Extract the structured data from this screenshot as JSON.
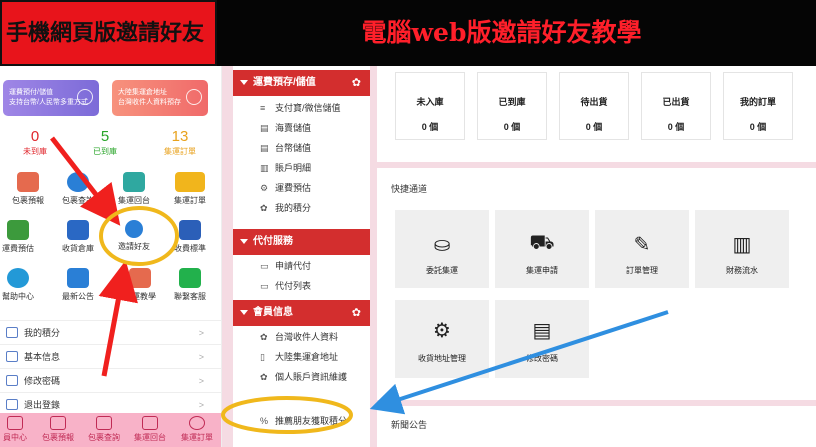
{
  "banners": {
    "left": "手機網頁版邀請好友",
    "right": "電腦web版邀請好友教學"
  },
  "phone": {
    "promo1": [
      "運費預付/儲值",
      "支持台幣/人民幣多重方式"
    ],
    "promo2": [
      "大陸集運倉地址",
      "台灣收件人資料預存"
    ],
    "stats": [
      {
        "num": "0",
        "label": "未到庫",
        "color": "#e0262c"
      },
      {
        "num": "5",
        "label": "已到庫",
        "color": "#2aa52a"
      },
      {
        "num": "13",
        "label": "集運訂單",
        "color": "#e8a21d"
      }
    ],
    "grid": [
      {
        "label": "包裹預報",
        "icon": "parcel-icon",
        "color": "#e56a4e"
      },
      {
        "label": "包裹查詢",
        "icon": "search-icon",
        "color": "#2a7fd6"
      },
      {
        "label": "集運回台",
        "icon": "box-icon",
        "color": "#2fa8a0"
      },
      {
        "label": "集運訂單",
        "icon": "truck-icon",
        "color": "#f1b51c"
      },
      {
        "label": "運費預估",
        "icon": "calculator-icon",
        "color": "#3c9a3c"
      },
      {
        "label": "收貨倉庫",
        "icon": "warehouse-icon",
        "color": "#2a68c4"
      },
      {
        "label": "邀請好友",
        "icon": "user-icon",
        "color": "#2a7fd6"
      },
      {
        "label": "收費標準",
        "icon": "layers-icon",
        "color": "#2b5fb8"
      },
      {
        "label": "幫助中心",
        "icon": "help-icon",
        "color": "#2399d7"
      },
      {
        "label": "最新公告",
        "icon": "announce-icon",
        "color": "#2a7fd6"
      },
      {
        "label": "集運教學",
        "icon": "book-icon",
        "color": "#e56a4e"
      },
      {
        "label": "聯繫客服",
        "icon": "line-icon",
        "color": "#22b14c"
      }
    ],
    "list": [
      "我的積分",
      "基本信息",
      "修改密碼",
      "退出登錄"
    ],
    "tabs": [
      "員中心",
      "包裹預報",
      "包裹查詢",
      "集運回台",
      "集運訂單"
    ]
  },
  "sidebar": {
    "sections": [
      {
        "title": "運費預存/儲值",
        "gear": "✿"
      },
      {
        "title": "代付服務",
        "gear": ""
      },
      {
        "title": "會員信息",
        "gear": "✿"
      }
    ],
    "group1": [
      {
        "icon": "≡",
        "label": "支付寶/微信儲值"
      },
      {
        "icon": "▤",
        "label": "海賣儲值"
      },
      {
        "icon": "▤",
        "label": "台幣儲值"
      },
      {
        "icon": "▥",
        "label": "賬戶明細"
      },
      {
        "icon": "⚙",
        "label": "運費預估"
      },
      {
        "icon": "✿",
        "label": "我的積分"
      }
    ],
    "group2": [
      {
        "icon": "▭",
        "label": "申請代付"
      },
      {
        "icon": "▭",
        "label": "代付列表"
      }
    ],
    "group3": [
      {
        "icon": "✿",
        "label": "台灣收件人資料"
      },
      {
        "icon": "▯",
        "label": "大陸集運倉地址"
      },
      {
        "icon": "✿",
        "label": "個人賬戶資訊維護"
      },
      {
        "icon": "",
        "label": ""
      },
      {
        "icon": "%",
        "label": "推薦朋友獲取積分"
      }
    ]
  },
  "orders": [
    {
      "label": "未入庫",
      "count": "0 個"
    },
    {
      "label": "已到庫",
      "count": "0 個"
    },
    {
      "label": "待出貨",
      "count": "0 個"
    },
    {
      "label": "已出貨",
      "count": "0 個"
    },
    {
      "label": "我的訂單",
      "count": "0 個"
    }
  ],
  "quick": {
    "title": "快捷通道",
    "items": [
      {
        "label": "委託集運",
        "glyph": "⛀"
      },
      {
        "label": "集運申請",
        "glyph": "⛟"
      },
      {
        "label": "訂單管理",
        "glyph": "✎"
      },
      {
        "label": "財務流水",
        "glyph": "▥"
      },
      {
        "label": "收貨地址管理",
        "glyph": "⚙"
      },
      {
        "label": "修改密碼",
        "glyph": "▤"
      }
    ]
  },
  "news": {
    "title": "新聞公告"
  },
  "colors": {
    "accent": "#d32e2e",
    "annotation": "#f0b81c",
    "arrow_red": "#f0201e",
    "arrow_blue": "#2f8fe0"
  }
}
